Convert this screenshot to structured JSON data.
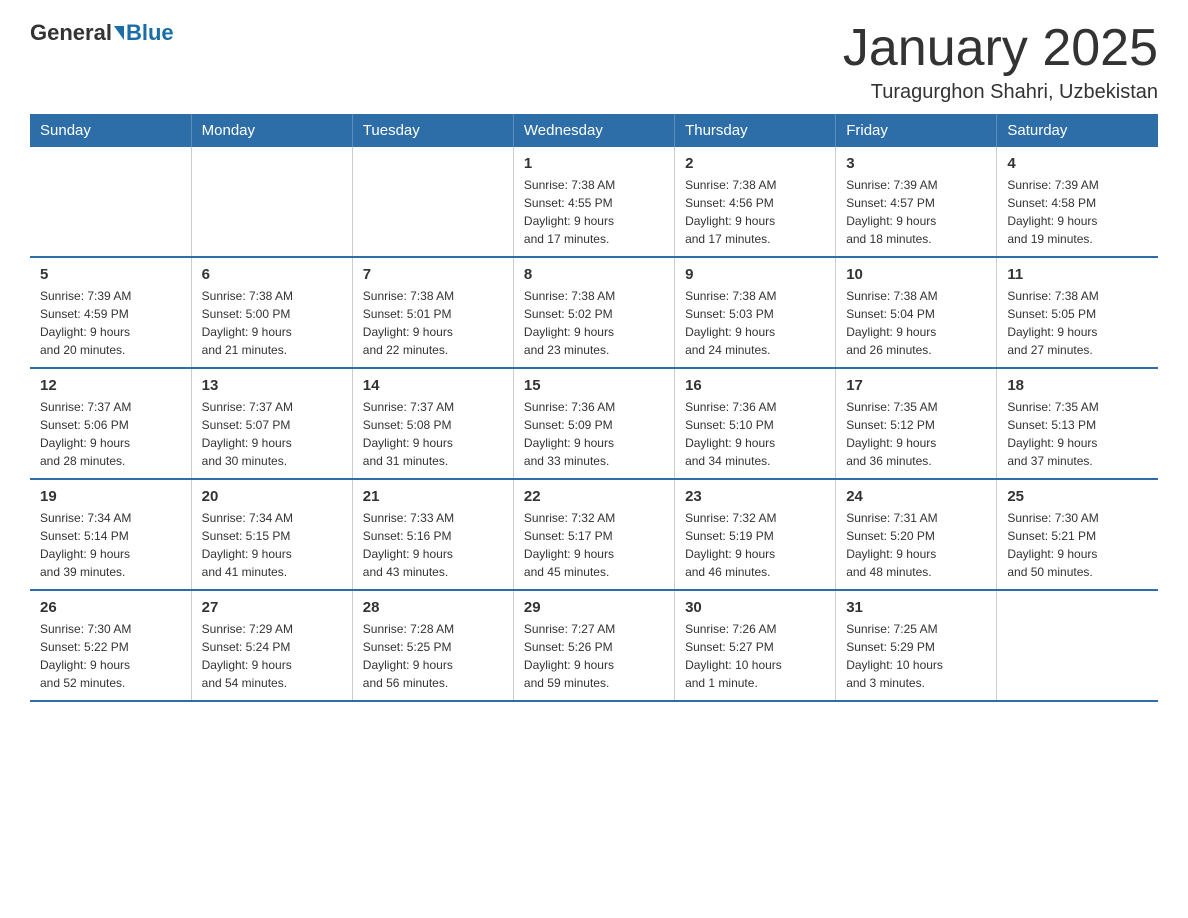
{
  "header": {
    "logo": {
      "general": "General",
      "blue": "Blue"
    },
    "title": "January 2025",
    "location": "Turagurghon Shahri, Uzbekistan"
  },
  "calendar": {
    "days_of_week": [
      "Sunday",
      "Monday",
      "Tuesday",
      "Wednesday",
      "Thursday",
      "Friday",
      "Saturday"
    ],
    "weeks": [
      [
        {
          "day": "",
          "info": ""
        },
        {
          "day": "",
          "info": ""
        },
        {
          "day": "",
          "info": ""
        },
        {
          "day": "1",
          "info": "Sunrise: 7:38 AM\nSunset: 4:55 PM\nDaylight: 9 hours\nand 17 minutes."
        },
        {
          "day": "2",
          "info": "Sunrise: 7:38 AM\nSunset: 4:56 PM\nDaylight: 9 hours\nand 17 minutes."
        },
        {
          "day": "3",
          "info": "Sunrise: 7:39 AM\nSunset: 4:57 PM\nDaylight: 9 hours\nand 18 minutes."
        },
        {
          "day": "4",
          "info": "Sunrise: 7:39 AM\nSunset: 4:58 PM\nDaylight: 9 hours\nand 19 minutes."
        }
      ],
      [
        {
          "day": "5",
          "info": "Sunrise: 7:39 AM\nSunset: 4:59 PM\nDaylight: 9 hours\nand 20 minutes."
        },
        {
          "day": "6",
          "info": "Sunrise: 7:38 AM\nSunset: 5:00 PM\nDaylight: 9 hours\nand 21 minutes."
        },
        {
          "day": "7",
          "info": "Sunrise: 7:38 AM\nSunset: 5:01 PM\nDaylight: 9 hours\nand 22 minutes."
        },
        {
          "day": "8",
          "info": "Sunrise: 7:38 AM\nSunset: 5:02 PM\nDaylight: 9 hours\nand 23 minutes."
        },
        {
          "day": "9",
          "info": "Sunrise: 7:38 AM\nSunset: 5:03 PM\nDaylight: 9 hours\nand 24 minutes."
        },
        {
          "day": "10",
          "info": "Sunrise: 7:38 AM\nSunset: 5:04 PM\nDaylight: 9 hours\nand 26 minutes."
        },
        {
          "day": "11",
          "info": "Sunrise: 7:38 AM\nSunset: 5:05 PM\nDaylight: 9 hours\nand 27 minutes."
        }
      ],
      [
        {
          "day": "12",
          "info": "Sunrise: 7:37 AM\nSunset: 5:06 PM\nDaylight: 9 hours\nand 28 minutes."
        },
        {
          "day": "13",
          "info": "Sunrise: 7:37 AM\nSunset: 5:07 PM\nDaylight: 9 hours\nand 30 minutes."
        },
        {
          "day": "14",
          "info": "Sunrise: 7:37 AM\nSunset: 5:08 PM\nDaylight: 9 hours\nand 31 minutes."
        },
        {
          "day": "15",
          "info": "Sunrise: 7:36 AM\nSunset: 5:09 PM\nDaylight: 9 hours\nand 33 minutes."
        },
        {
          "day": "16",
          "info": "Sunrise: 7:36 AM\nSunset: 5:10 PM\nDaylight: 9 hours\nand 34 minutes."
        },
        {
          "day": "17",
          "info": "Sunrise: 7:35 AM\nSunset: 5:12 PM\nDaylight: 9 hours\nand 36 minutes."
        },
        {
          "day": "18",
          "info": "Sunrise: 7:35 AM\nSunset: 5:13 PM\nDaylight: 9 hours\nand 37 minutes."
        }
      ],
      [
        {
          "day": "19",
          "info": "Sunrise: 7:34 AM\nSunset: 5:14 PM\nDaylight: 9 hours\nand 39 minutes."
        },
        {
          "day": "20",
          "info": "Sunrise: 7:34 AM\nSunset: 5:15 PM\nDaylight: 9 hours\nand 41 minutes."
        },
        {
          "day": "21",
          "info": "Sunrise: 7:33 AM\nSunset: 5:16 PM\nDaylight: 9 hours\nand 43 minutes."
        },
        {
          "day": "22",
          "info": "Sunrise: 7:32 AM\nSunset: 5:17 PM\nDaylight: 9 hours\nand 45 minutes."
        },
        {
          "day": "23",
          "info": "Sunrise: 7:32 AM\nSunset: 5:19 PM\nDaylight: 9 hours\nand 46 minutes."
        },
        {
          "day": "24",
          "info": "Sunrise: 7:31 AM\nSunset: 5:20 PM\nDaylight: 9 hours\nand 48 minutes."
        },
        {
          "day": "25",
          "info": "Sunrise: 7:30 AM\nSunset: 5:21 PM\nDaylight: 9 hours\nand 50 minutes."
        }
      ],
      [
        {
          "day": "26",
          "info": "Sunrise: 7:30 AM\nSunset: 5:22 PM\nDaylight: 9 hours\nand 52 minutes."
        },
        {
          "day": "27",
          "info": "Sunrise: 7:29 AM\nSunset: 5:24 PM\nDaylight: 9 hours\nand 54 minutes."
        },
        {
          "day": "28",
          "info": "Sunrise: 7:28 AM\nSunset: 5:25 PM\nDaylight: 9 hours\nand 56 minutes."
        },
        {
          "day": "29",
          "info": "Sunrise: 7:27 AM\nSunset: 5:26 PM\nDaylight: 9 hours\nand 59 minutes."
        },
        {
          "day": "30",
          "info": "Sunrise: 7:26 AM\nSunset: 5:27 PM\nDaylight: 10 hours\nand 1 minute."
        },
        {
          "day": "31",
          "info": "Sunrise: 7:25 AM\nSunset: 5:29 PM\nDaylight: 10 hours\nand 3 minutes."
        },
        {
          "day": "",
          "info": ""
        }
      ]
    ]
  }
}
